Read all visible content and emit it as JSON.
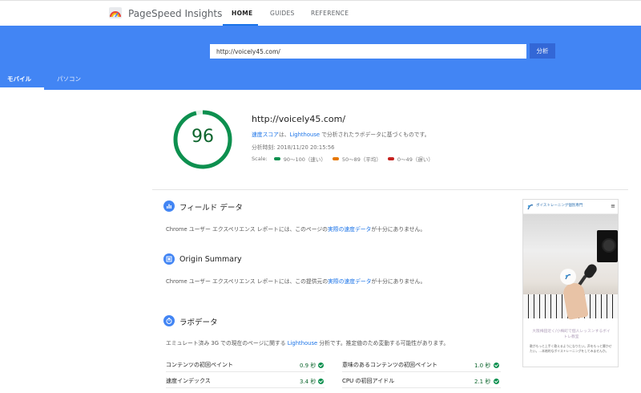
{
  "nav": {
    "brand": "PageSpeed Insights",
    "links": [
      "HOME",
      "GUIDES",
      "REFERENCE"
    ],
    "active": "HOME"
  },
  "search": {
    "url_value": "http://voicely45.com/",
    "analyze_label": "分析"
  },
  "tabs": [
    "モバイル",
    "パソコン"
  ],
  "summary": {
    "score": "96",
    "url": "http://voicely45.com/",
    "desc_link": "速度スコア",
    "desc_mid": "は、",
    "desc_link2": "Lighthouse",
    "desc_end": " で分析されたラボデータに基づくものです。",
    "time": "分析時刻: 2018/11/20 20:15:56",
    "scale_label": "Scale:",
    "scale": [
      {
        "label": "90〜100（速い）",
        "color": "#0d904f"
      },
      {
        "label": "50〜89（平均）",
        "color": "#e67700"
      },
      {
        "label": "0〜49（遅い）",
        "color": "#c5221f"
      }
    ]
  },
  "field": {
    "title": "フィールド データ",
    "body_pre": "Chrome ユーザー エクスペリエンス レポートには、このページの",
    "body_link": "実際の速度データ",
    "body_post": "が十分にありません。"
  },
  "origin": {
    "title": "Origin Summary",
    "body_pre": "Chrome ユーザー エクスペリエンス レポートには、この提供元の",
    "body_link": "実際の速度データ",
    "body_post": "が十分にありません。"
  },
  "lab": {
    "title": "ラボデータ",
    "body_pre": "エミュレート済み 3G での現在のページに関する ",
    "body_link": "Lighthouse",
    "body_post": " 分析です。推定値のため変動する可能性があります。",
    "metrics": [
      {
        "label": "コンテンツの初回ペイント",
        "value": "0.9 秒"
      },
      {
        "label": "意味のあるコンテンツの初回ペイント",
        "value": "1.0 秒"
      },
      {
        "label": "速度インデックス",
        "value": "3.4 秒"
      },
      {
        "label": "CPU の初回アイドル",
        "value": "2.1 秒"
      }
    ]
  },
  "preview": {
    "brand": "ボイストレーニング個別専門",
    "menu": "≡",
    "caption": "大阪梅田近く/小梅町で個人レッスンするボイトレ教室",
    "text": "歌がもっと上手く歌えるようになりたい。声をもっと響かせたい。…本格的なボイストレーニングをしてみませんか。"
  }
}
